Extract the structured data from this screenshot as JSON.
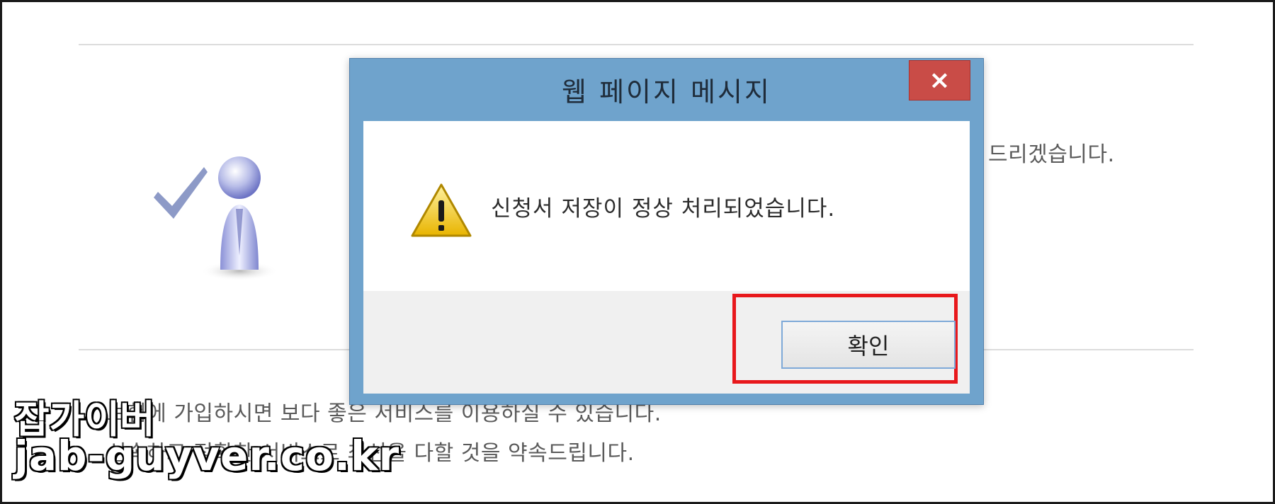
{
  "background": {
    "right_text": "드리겠습니다.",
    "line1": "보험에 가입하시면 보다 좋은 서비스를 이용하실 수 있습니다.",
    "line2": "신속하고 정확한 서비스로 최선을 다할 것을 약속드립니다."
  },
  "dialog": {
    "title": "웹 페이지 메시지",
    "close_label": "×",
    "message": "신청서 저장이 정상 처리되었습니다.",
    "ok_label": "확인",
    "icons": {
      "warning": "warning-icon",
      "close": "close-icon",
      "user": "user-check-icon"
    }
  },
  "colors": {
    "titlebar": "#6fa3cc",
    "close_button": "#c94c47",
    "highlight": "#e8181c"
  },
  "watermark": {
    "line1": "잡가이버",
    "line2": "jab-guyver.co.kr"
  }
}
